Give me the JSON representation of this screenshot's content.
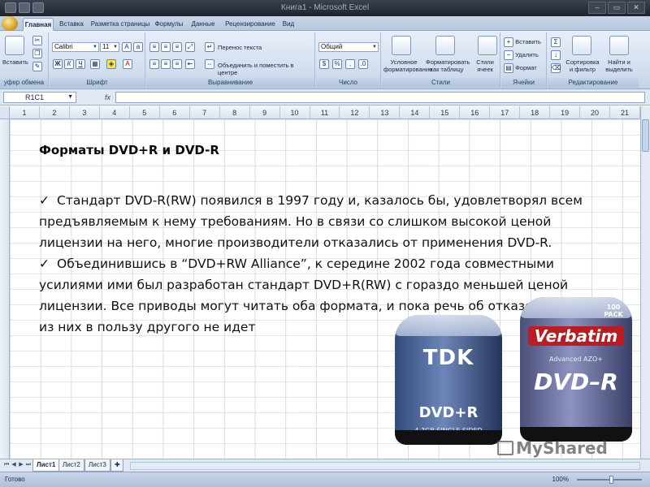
{
  "window": {
    "title": "Книга1 - Microsoft Excel",
    "minimize": "–",
    "maximize": "▭",
    "close": "✕"
  },
  "ribbon_tabs": [
    {
      "label": "Главная",
      "active": true
    },
    {
      "label": "Вставка"
    },
    {
      "label": "Разметка страницы"
    },
    {
      "label": "Формулы"
    },
    {
      "label": "Данные"
    },
    {
      "label": "Рецензирование"
    },
    {
      "label": "Вид"
    }
  ],
  "ribbon": {
    "clipboard": {
      "paste": "Вставить",
      "group": "уфер обмена"
    },
    "font": {
      "name": "Calibri",
      "size": "11",
      "bold": "Ж",
      "italic": "К",
      "underline": "Ч",
      "group": "Шрифт"
    },
    "alignment": {
      "wrap": "Перенос текста",
      "merge": "Объединить и поместить в центре",
      "group": "Выравнивание"
    },
    "number": {
      "format": "Общий",
      "group": "Число"
    },
    "styles": {
      "conditional": "Условное форматирование",
      "table": "Форматировать как таблицу",
      "cell": "Стили ячеек",
      "group": "Стили"
    },
    "cells": {
      "insert": "Вставить",
      "delete": "Удалить",
      "format": "Формат",
      "group": "Ячейки"
    },
    "editing": {
      "sort": "Сортировка и фильтр",
      "find": "Найти и выделить",
      "group": "Редактирование"
    }
  },
  "formula_bar": {
    "name_box": "R1C1",
    "fx": "fx",
    "value": ""
  },
  "columns": [
    "1",
    "2",
    "3",
    "4",
    "5",
    "6",
    "7",
    "8",
    "9",
    "10",
    "11",
    "12",
    "13",
    "14",
    "15",
    "16",
    "17",
    "18",
    "19",
    "20",
    "21"
  ],
  "content": {
    "heading": "Форматы DVD+R и DVD-R",
    "bullets": [
      "Стандарт DVD-R(RW) появился в 1997 году и, казалось бы, удовлетворял всем предъявляемым к нему требованиям. Но в связи со слишком высокой ценой лицензии на него, многие производители отказались от применения DVD-R.",
      "Объединившись в “DVD+RW Alliance”, к середине 2002 года совместными усилиями ими был разработан стандарт DVD+R(RW) с гораздо меньшей ценой лицензии. Все приводы могут читать оба формата, и пока речь об отказе от одного из них в пользу другого не идет"
    ]
  },
  "images": {
    "tdk": {
      "brand": "TDK",
      "format": "DVD+R",
      "capacity": "4.7GB SINGLE SIDED"
    },
    "verbatim": {
      "brand": "Verbatim",
      "format": "DVD–R",
      "sub": "Advanced AZO+",
      "badge": "100 PACK"
    }
  },
  "watermark": "MyShared",
  "sheets": [
    {
      "label": "Лист1",
      "active": true
    },
    {
      "label": "Лист2"
    },
    {
      "label": "Лист3"
    }
  ],
  "status": {
    "ready": "Готово",
    "zoom": "100%"
  }
}
